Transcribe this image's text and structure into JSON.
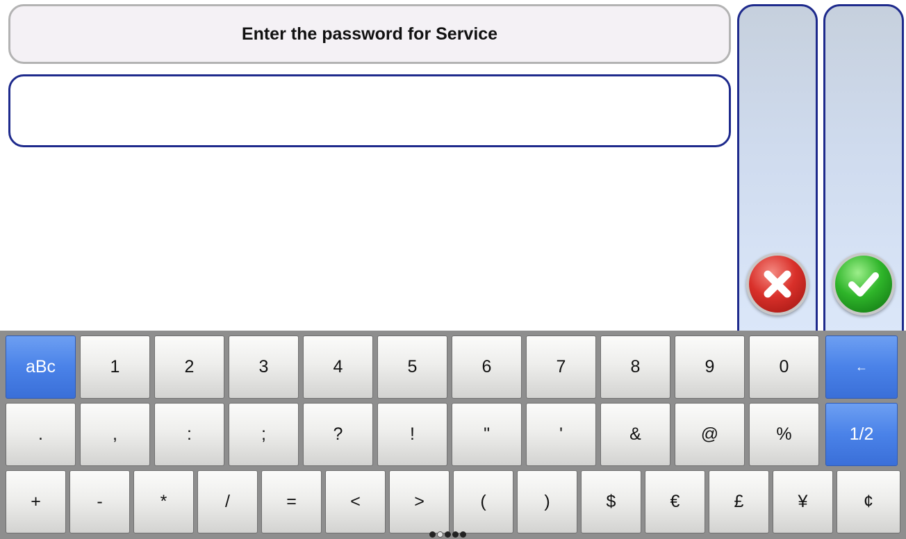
{
  "prompt": {
    "title": "Enter the password for Service"
  },
  "password": {
    "value": ""
  },
  "actions": {
    "cancel_icon": "close-icon",
    "confirm_icon": "checkmark-icon"
  },
  "keyboard": {
    "row1": [
      "aBc",
      "1",
      "2",
      "3",
      "4",
      "5",
      "6",
      "7",
      "8",
      "9",
      "0",
      "←"
    ],
    "row2": [
      ".",
      ",",
      ":",
      ";",
      "?",
      "!",
      "\"",
      "'",
      "&",
      "@",
      "%",
      "1/2"
    ],
    "row3": [
      "+",
      "-",
      "*",
      "/",
      "=",
      "<",
      ">",
      "(",
      ")",
      "$",
      "€",
      "£",
      "¥",
      "¢"
    ]
  },
  "colors": {
    "accent_blue": "#4a82e8",
    "border_navy": "#1e2a8c",
    "cancel_red": "#d9302a",
    "confirm_green": "#2fb52a"
  }
}
